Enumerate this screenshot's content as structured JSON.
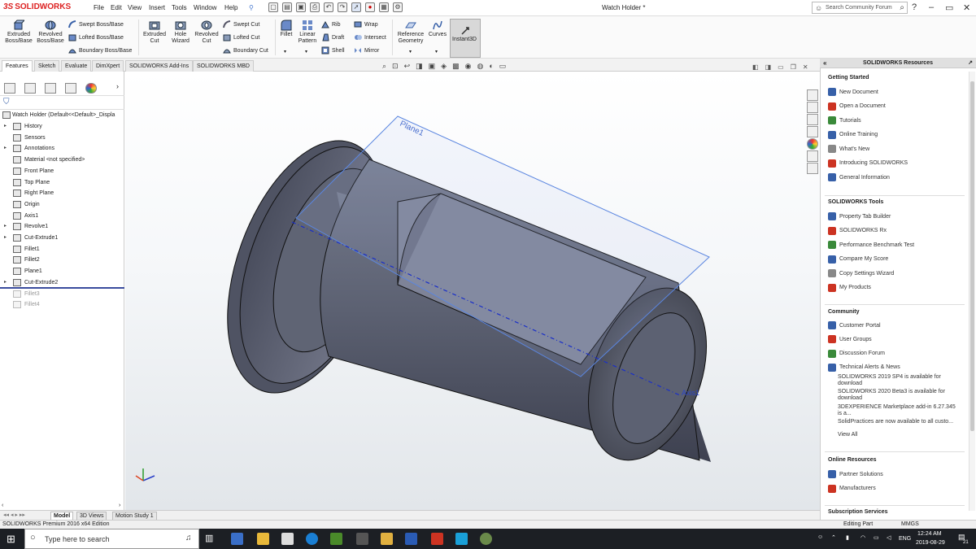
{
  "app": {
    "logo_text": "SOLIDWORKS",
    "document_title": "Watch Holder *",
    "menu": [
      "File",
      "Edit",
      "View",
      "Insert",
      "Tools",
      "Window",
      "Help"
    ],
    "search_placeholder": "Search Community Forum"
  },
  "toolbar": {
    "extruded_boss": "Extruded Boss/Base",
    "revolved_boss": "Revolved Boss/Base",
    "swept_boss": "Swept Boss/Base",
    "lofted_boss": "Lofted Boss/Base",
    "boundary_boss": "Boundary Boss/Base",
    "extruded_cut": "Extruded Cut",
    "hole_wizard": "Hole Wizard",
    "revolved_cut": "Revolved Cut",
    "swept_cut": "Swept Cut",
    "lofted_cut": "Lofted Cut",
    "boundary_cut": "Boundary Cut",
    "fillet": "Fillet",
    "linear_pattern": "Linear Pattern",
    "rib": "Rib",
    "draft": "Draft",
    "shell": "Shell",
    "wrap": "Wrap",
    "intersect": "Intersect",
    "mirror": "Mirror",
    "reference_geometry": "Reference Geometry",
    "curves": "Curves",
    "instant3d": "Instant3D"
  },
  "command_tabs": [
    "Features",
    "Sketch",
    "Evaluate",
    "DimXpert",
    "SOLIDWORKS Add-Ins",
    "SOLIDWORKS MBD"
  ],
  "feature_tree": {
    "root": "Watch Holder  (Default<<Default>_Displa",
    "items": [
      {
        "label": "History",
        "expand": "▸",
        "dim": false
      },
      {
        "label": "Sensors",
        "expand": "",
        "dim": false
      },
      {
        "label": "Annotations",
        "expand": "▸",
        "dim": false
      },
      {
        "label": "Material <not specified>",
        "expand": "",
        "dim": false
      },
      {
        "label": "Front Plane",
        "expand": "",
        "dim": false
      },
      {
        "label": "Top Plane",
        "expand": "",
        "dim": false
      },
      {
        "label": "Right Plane",
        "expand": "",
        "dim": false
      },
      {
        "label": "Origin",
        "expand": "",
        "dim": false
      },
      {
        "label": "Axis1",
        "expand": "",
        "dim": false
      },
      {
        "label": "Revolve1",
        "expand": "▸",
        "dim": false
      },
      {
        "label": "Cut-Extrude1",
        "expand": "▸",
        "dim": false
      },
      {
        "label": "Fillet1",
        "expand": "",
        "dim": false
      },
      {
        "label": "Fillet2",
        "expand": "",
        "dim": false
      },
      {
        "label": "Plane1",
        "expand": "",
        "dim": false
      },
      {
        "label": "Cut-Extrude2",
        "expand": "▸",
        "dim": false
      },
      {
        "label": "Fillet3",
        "expand": "",
        "dim": true
      },
      {
        "label": "Fillet4",
        "expand": "",
        "dim": true
      }
    ]
  },
  "viewport": {
    "plane_label": "Plane1",
    "axis_label": "Axis1"
  },
  "bottom_tabs": [
    "Model",
    "3D Views",
    "Motion Study 1"
  ],
  "task_pane": {
    "title": "SOLIDWORKS Resources",
    "getting_started": {
      "title": "Getting Started",
      "items": [
        "New Document",
        "Open a Document",
        "Tutorials",
        "Online Training",
        "What's New",
        "Introducing SOLIDWORKS",
        "General Information"
      ]
    },
    "tools": {
      "title": "SOLIDWORKS Tools",
      "items": [
        "Property Tab Builder",
        "SOLIDWORKS Rx",
        "Performance Benchmark Test",
        "Compare My Score",
        "Copy Settings Wizard",
        "My Products"
      ]
    },
    "community": {
      "title": "Community",
      "items": [
        "Customer Portal",
        "User Groups",
        "Discussion Forum",
        "Technical Alerts & News"
      ],
      "news": [
        "SOLIDWORKS 2019 SP4 is available for download",
        "SOLIDWORKS 2020 Beta3 is available for download",
        "3DEXPERIENCE Marketplace add-in 6.27.345 is a...",
        "SolidPractices are now available to all custo..."
      ],
      "view_all": "View All"
    },
    "online": {
      "title": "Online Resources",
      "items": [
        "Partner Solutions",
        "Manufacturers"
      ]
    },
    "subscription": {
      "title": "Subscription Services"
    }
  },
  "status_bar": {
    "edition": "SOLIDWORKS Premium 2016 x64 Edition",
    "mode": "Editing Part",
    "units": "MMGS"
  },
  "taskbar": {
    "search_placeholder": "Type here to search",
    "lang": "ENG",
    "time": "12:24 AM",
    "date": "2019-08-29",
    "notif_count": "21"
  },
  "colors": {
    "accent": "#d22222",
    "rollback": "#3a4c9e",
    "model_shade": "#5f6474"
  }
}
